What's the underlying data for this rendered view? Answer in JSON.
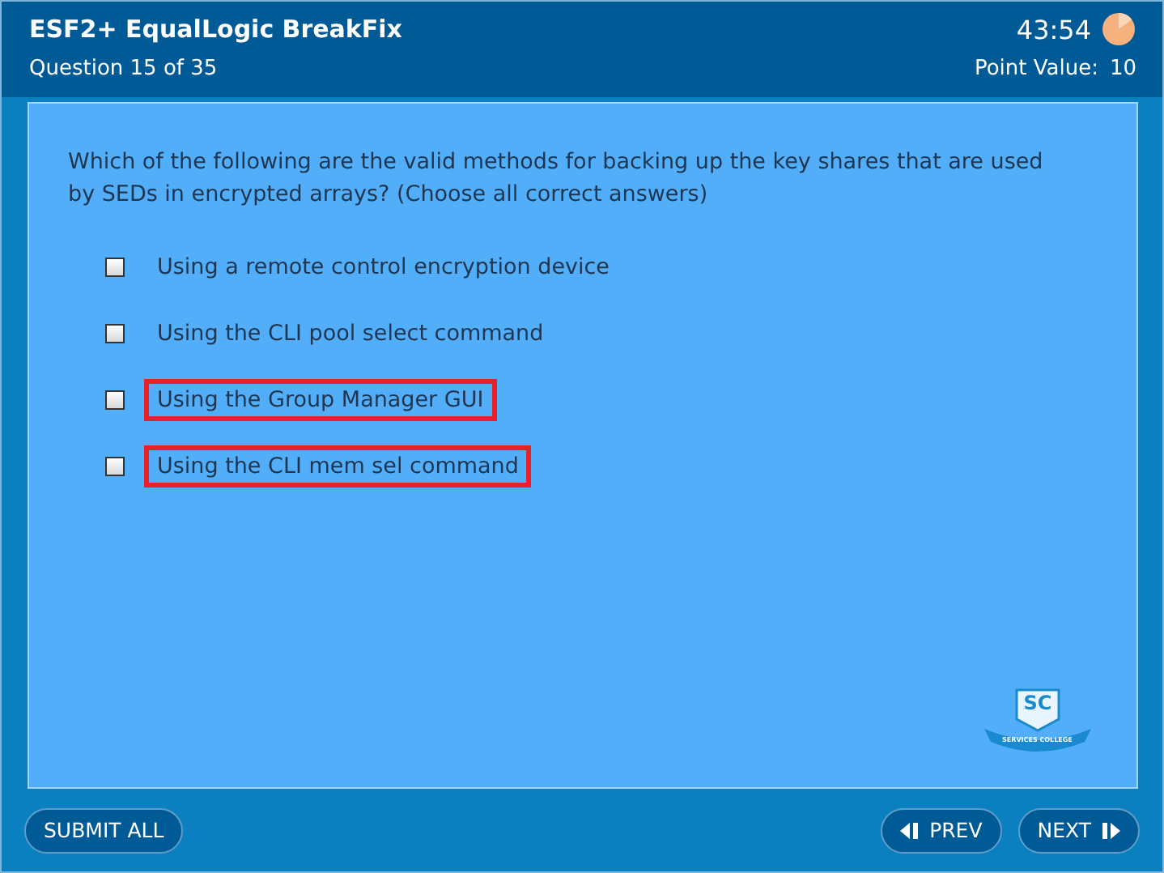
{
  "header": {
    "title": "ESF2+ EqualLogic BreakFix",
    "timer": "43:54",
    "progress": "Question 15 of 35",
    "point_label": "Point Value:",
    "point_value": "10"
  },
  "question": {
    "text": "Which of the following are the valid methods for backing up the key shares that are used by SEDs in encrypted arrays? (Choose all correct answers)",
    "options": [
      {
        "label": "Using a remote control encryption device",
        "checked": false,
        "highlighted": false
      },
      {
        "label": "Using the CLI pool select command",
        "checked": false,
        "highlighted": false
      },
      {
        "label": "Using the Group Manager GUI",
        "checked": false,
        "highlighted": true
      },
      {
        "label": "Using the CLI mem sel command",
        "checked": false,
        "highlighted": true
      }
    ]
  },
  "logo": {
    "initials": "SC",
    "ribbon": "SERVICES COLLEGE"
  },
  "footer": {
    "submit": "SUBMIT ALL",
    "prev": "PREV",
    "next": "NEXT"
  }
}
